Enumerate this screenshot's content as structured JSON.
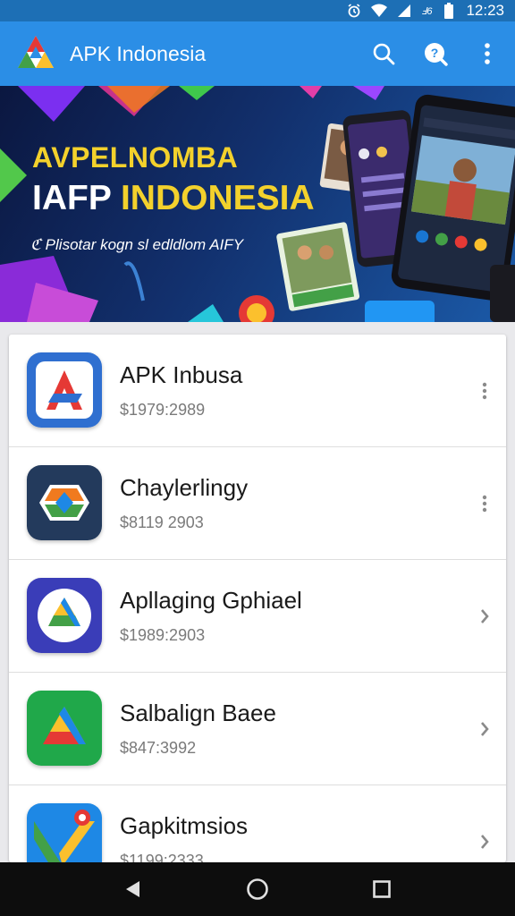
{
  "status_bar": {
    "network": "Ⅎ6",
    "time": "12:23"
  },
  "app_bar": {
    "title": "APK Indonesia",
    "color": "#2b8ee6"
  },
  "banner": {
    "title_line1": "AVPELNOMBA",
    "title_line2_a": "IAFP ",
    "title_line2_b": "INDONESIA",
    "subtitle": "ℭ Plisotar kogn sl edldlom AIFY"
  },
  "apps": [
    {
      "name": "APK Inbusa",
      "price": "$1979:2989",
      "icon": "apk-letters-icon",
      "action": "more"
    },
    {
      "name": "Chaylerlingy",
      "price": "$8119 2903",
      "icon": "drive-hexagon-icon",
      "action": "more"
    },
    {
      "name": "Apllaging Gphiael",
      "price": "$1989:2903",
      "icon": "drive-circle-icon",
      "action": "chevron"
    },
    {
      "name": "Salbalign Baee",
      "price": "$847:3992",
      "icon": "drive-green-icon",
      "action": "chevron"
    },
    {
      "name": "Gapkitmsios",
      "price": "$1199:2333",
      "icon": "maps-icon",
      "action": "chevron"
    }
  ]
}
